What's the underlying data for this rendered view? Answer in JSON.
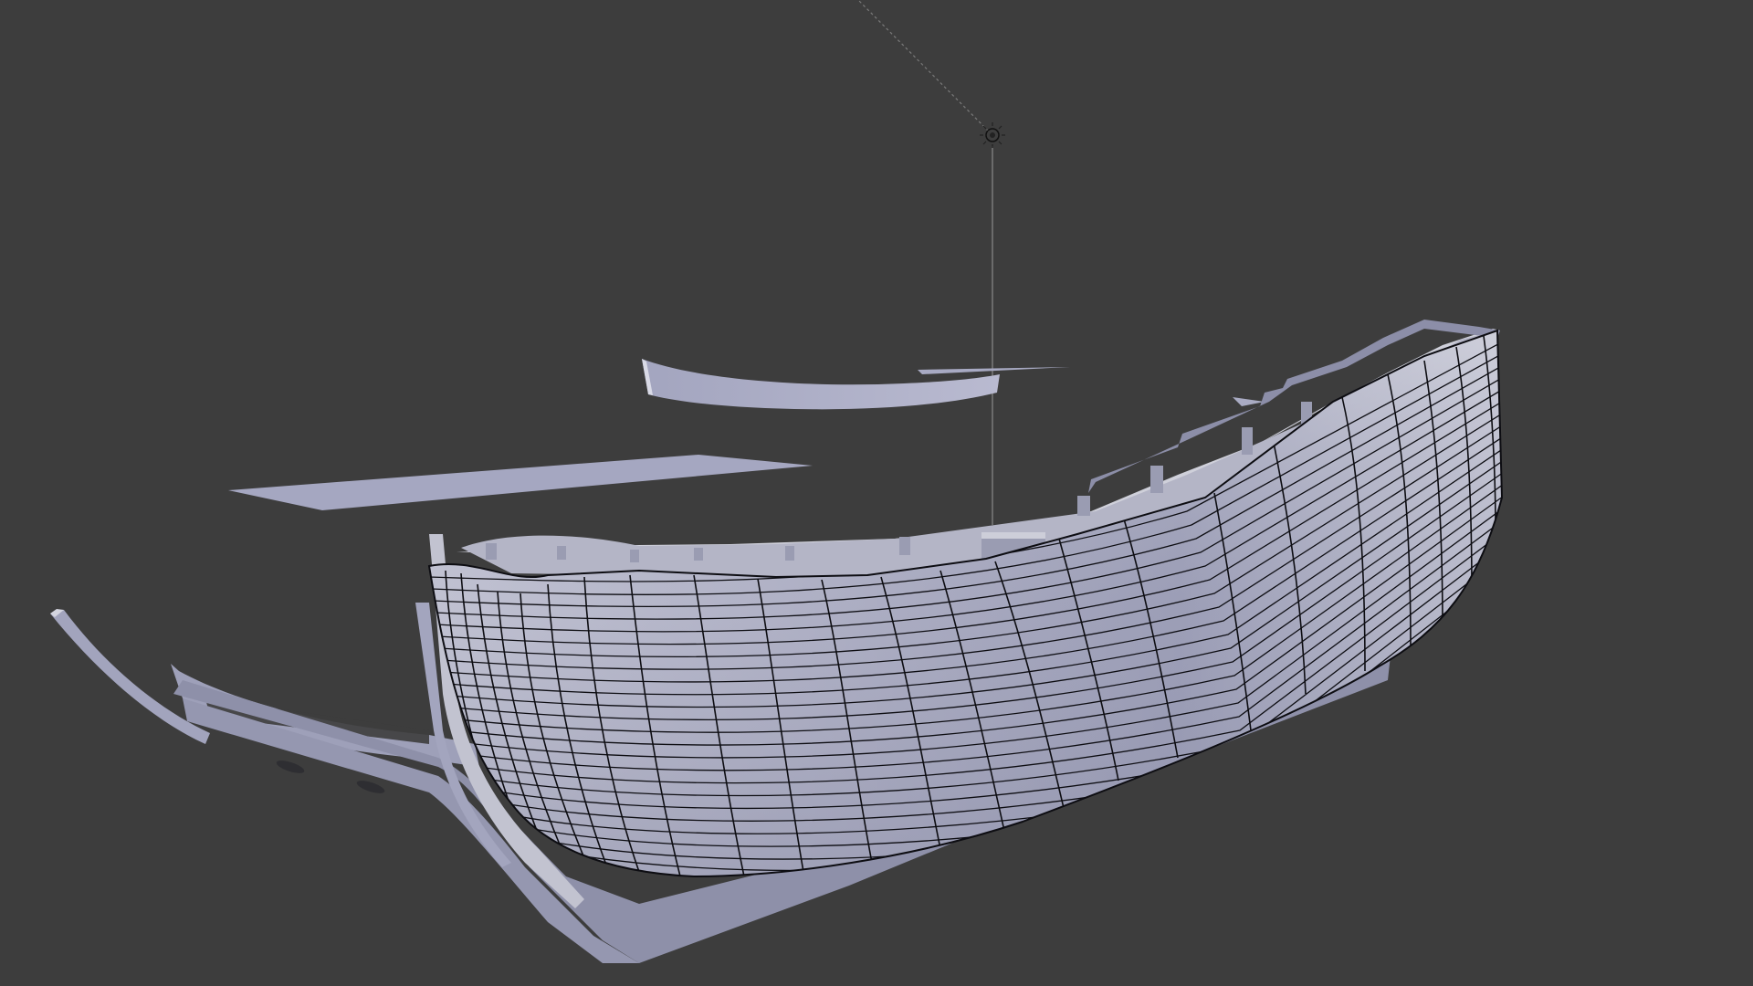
{
  "app": {
    "viewport": "3d-viewport"
  },
  "scene": {
    "background_color": "#3d3d3d",
    "hull_color": "#9a9cb4",
    "hull_light_color": "#c8c9d6",
    "deck_color": "#bfc0cb",
    "wire_color": "#0d0d12",
    "plank_color": "#a7a9c2",
    "objects": [
      {
        "name": "lamp-light",
        "type": "light"
      },
      {
        "name": "hull-mesh",
        "type": "mesh",
        "selected": true
      },
      {
        "name": "deck-beam",
        "type": "mesh"
      },
      {
        "name": "keel-profile",
        "type": "mesh"
      },
      {
        "name": "plank-top",
        "type": "mesh"
      },
      {
        "name": "plank-long",
        "type": "mesh"
      }
    ]
  }
}
